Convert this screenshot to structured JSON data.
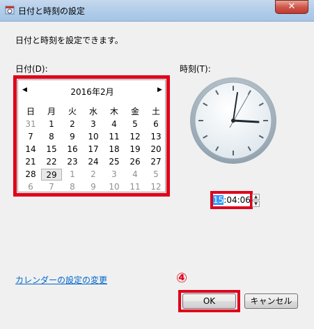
{
  "window": {
    "title": "日付と時刻の設定",
    "close_label": "✕"
  },
  "instruction": "日付と時刻を設定できます。",
  "date_label": "日付(D):",
  "time_label": "時刻(T):",
  "calendar": {
    "prev_label": "◀",
    "next_label": "▶",
    "month_title": "2016年2月",
    "weekdays": [
      "日",
      "月",
      "火",
      "水",
      "木",
      "金",
      "土"
    ],
    "weeks": [
      [
        "31",
        "1",
        "2",
        "3",
        "4",
        "5",
        "6"
      ],
      [
        "7",
        "8",
        "9",
        "10",
        "11",
        "12",
        "13"
      ],
      [
        "14",
        "15",
        "16",
        "17",
        "18",
        "19",
        "20"
      ],
      [
        "21",
        "22",
        "23",
        "24",
        "25",
        "26",
        "27"
      ],
      [
        "28",
        "29",
        "1",
        "2",
        "3",
        "4",
        "5"
      ],
      [
        "6",
        "7",
        "8",
        "9",
        "10",
        "11",
        "12"
      ]
    ],
    "selected_day": "29"
  },
  "time": {
    "hour": "15",
    "rest": ":04:06"
  },
  "link_label": "カレンダーの設定の変更",
  "step_marker": "④",
  "buttons": {
    "ok": "OK",
    "cancel": "キャンセル"
  },
  "colors": {
    "highlight": "#e0001b",
    "link": "#0066cc",
    "selection": "#3399ff"
  }
}
